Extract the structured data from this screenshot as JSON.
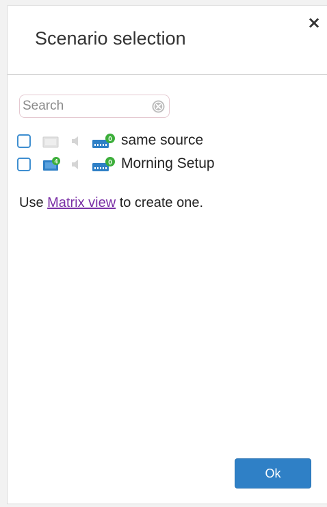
{
  "dialog": {
    "title": "Scenario selection",
    "close_label": "×"
  },
  "search": {
    "placeholder": "Search",
    "value": ""
  },
  "scenarios": [
    {
      "label": "same source",
      "checked": false,
      "video_active": false,
      "video_badge": "",
      "matrix_badge": "0"
    },
    {
      "label": "Morning Setup",
      "checked": false,
      "video_active": true,
      "video_badge": "4",
      "matrix_badge": "0"
    }
  ],
  "hint": {
    "prefix": "Use ",
    "link": "Matrix view",
    "suffix": " to create one."
  },
  "footer": {
    "ok_label": "Ok"
  },
  "icons": {
    "close": "close-icon",
    "clear": "clear-search-icon",
    "video": "video-icon",
    "audio": "audio-icon",
    "matrix": "matrix-icon"
  },
  "colors": {
    "accent": "#2f80c6",
    "checkbox_border": "#3e8ed0",
    "link": "#7a2fa6",
    "badge": "#3cae3a"
  }
}
